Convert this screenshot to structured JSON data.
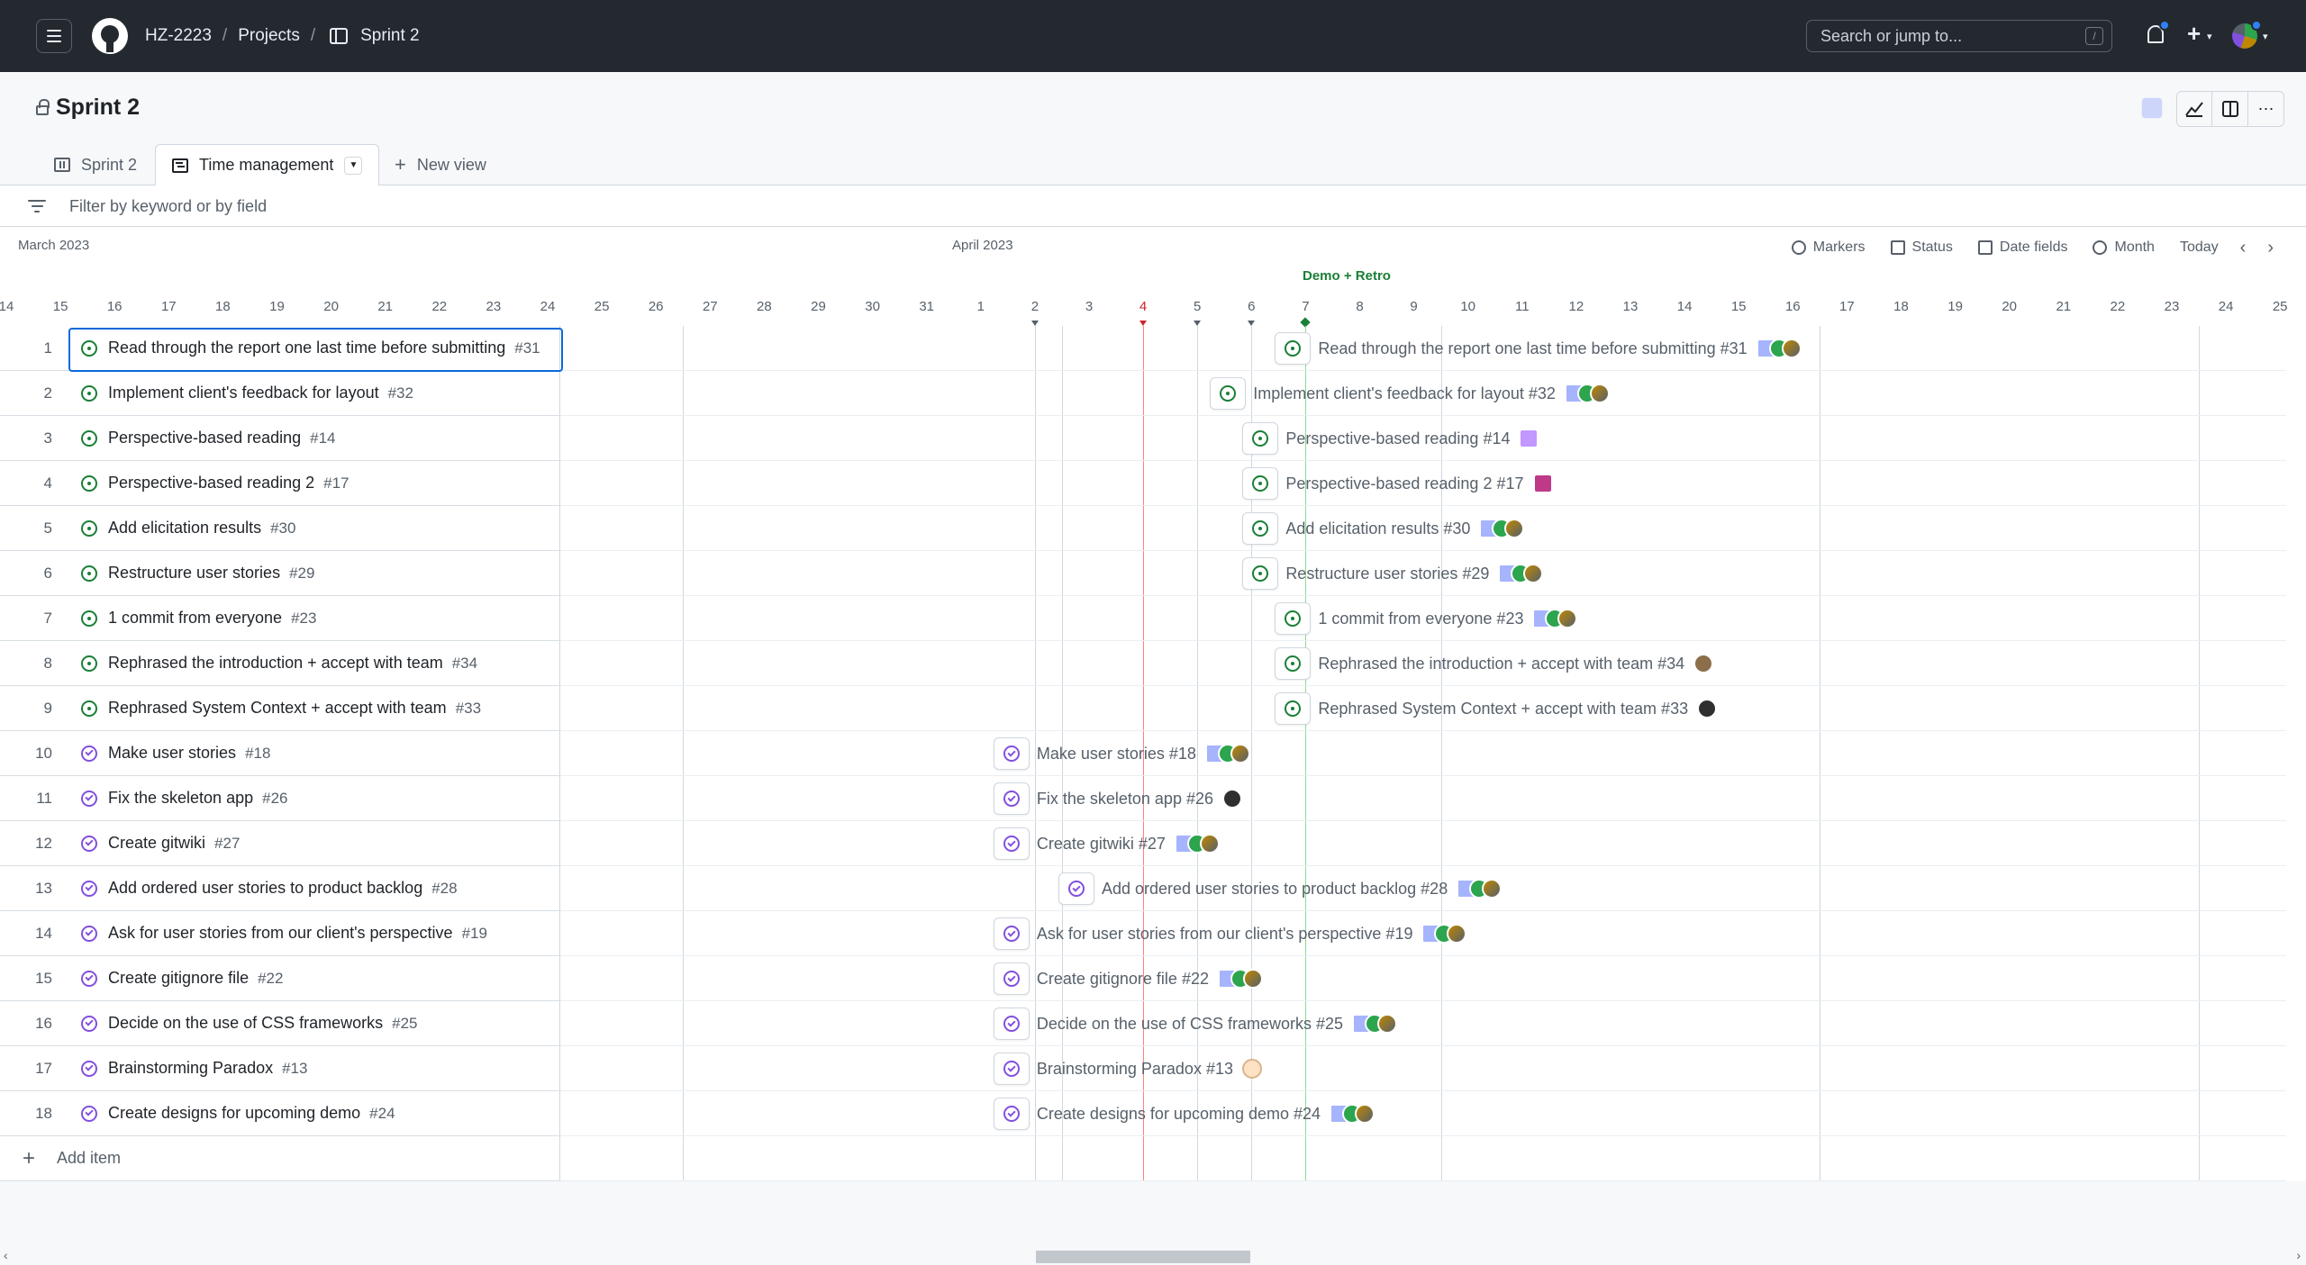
{
  "header": {
    "org": "HZ-2223",
    "projects": "Projects",
    "board": "Sprint 2",
    "search_placeholder": "Search or jump to...",
    "search_key": "/"
  },
  "project": {
    "title": "Sprint 2"
  },
  "tabs": [
    {
      "label": "Sprint 2"
    },
    {
      "label": "Time management"
    },
    {
      "label": "New view"
    }
  ],
  "filter": {
    "placeholder": "Filter by keyword or by field"
  },
  "timeline": {
    "months": [
      "March 2023",
      "April 2023"
    ],
    "controls": {
      "markers": "Markers",
      "status": "Status",
      "date_fields": "Date fields",
      "zoom": "Month",
      "today": "Today"
    },
    "marker_label": "Demo + Retro",
    "days": [
      "14",
      "15",
      "16",
      "17",
      "18",
      "19",
      "20",
      "21",
      "22",
      "23",
      "24",
      "25",
      "26",
      "27",
      "28",
      "29",
      "30",
      "31",
      "1",
      "2",
      "3",
      "4",
      "5",
      "6",
      "7",
      "8",
      "9",
      "10",
      "11",
      "12",
      "13",
      "14",
      "15",
      "16",
      "17",
      "18",
      "19",
      "20",
      "21",
      "22",
      "23",
      "24",
      "25"
    ],
    "today_day": "4",
    "add_item": "Add item"
  },
  "items": [
    {
      "n": "1",
      "title": "Read through the report one last time before submitting",
      "issue": "#31",
      "state": "open"
    },
    {
      "n": "2",
      "title": "Implement client's feedback for layout",
      "issue": "#32",
      "state": "open"
    },
    {
      "n": "3",
      "title": "Perspective-based reading",
      "issue": "#14",
      "state": "open"
    },
    {
      "n": "4",
      "title": "Perspective-based reading 2",
      "issue": "#17",
      "state": "open"
    },
    {
      "n": "5",
      "title": "Add elicitation results",
      "issue": "#30",
      "state": "open"
    },
    {
      "n": "6",
      "title": "Restructure user stories",
      "issue": "#29",
      "state": "open"
    },
    {
      "n": "7",
      "title": "1 commit from everyone",
      "issue": "#23",
      "state": "open"
    },
    {
      "n": "8",
      "title": "Rephrased the introduction + accept with team",
      "issue": "#34",
      "state": "open"
    },
    {
      "n": "9",
      "title": "Rephrased System Context + accept with team",
      "issue": "#33",
      "state": "open"
    },
    {
      "n": "10",
      "title": "Make user stories",
      "issue": "#18",
      "state": "done"
    },
    {
      "n": "11",
      "title": "Fix the skeleton app",
      "issue": "#26",
      "state": "done"
    },
    {
      "n": "12",
      "title": "Create gitwiki",
      "issue": "#27",
      "state": "done"
    },
    {
      "n": "13",
      "title": "Add ordered user stories to product backlog",
      "issue": "#28",
      "state": "done"
    },
    {
      "n": "14",
      "title": "Ask for user stories from our client's perspective",
      "issue": "#19",
      "state": "done"
    },
    {
      "n": "15",
      "title": "Create gitignore file",
      "issue": "#22",
      "state": "done"
    },
    {
      "n": "16",
      "title": "Decide on the use of CSS frameworks",
      "issue": "#25",
      "state": "done"
    },
    {
      "n": "17",
      "title": "Brainstorming Paradox",
      "issue": "#13",
      "state": "done"
    },
    {
      "n": "18",
      "title": "Create designs for upcoming demo",
      "issue": "#24",
      "state": "done"
    }
  ],
  "bar_labels": [
    "Read through the report one last time before submitting #31",
    "Implement client's feedback for layout #32",
    "Perspective-based reading #14",
    "Perspective-based reading 2 #17",
    "Add elicitation results #30",
    "Restructure user stories #29",
    "1 commit from everyone #23",
    "Rephrased the introduction + accept with team #34",
    "Rephrased System Context + accept with team #33",
    "Make user stories #18",
    "Fix the skeleton app #26",
    "Create gitwiki #27",
    "Add ordered user stories to product backlog #28",
    "Ask for user stories from our client's perspective #19",
    "Create gitignore file #22",
    "Decide on the use of CSS frameworks #25",
    "Brainstorming Paradox #13",
    "Create designs for upcoming demo #24"
  ],
  "colors": {
    "open": "#1a7f37",
    "done": "#8250df",
    "today": "#cf222e",
    "accent": "#0969da"
  }
}
